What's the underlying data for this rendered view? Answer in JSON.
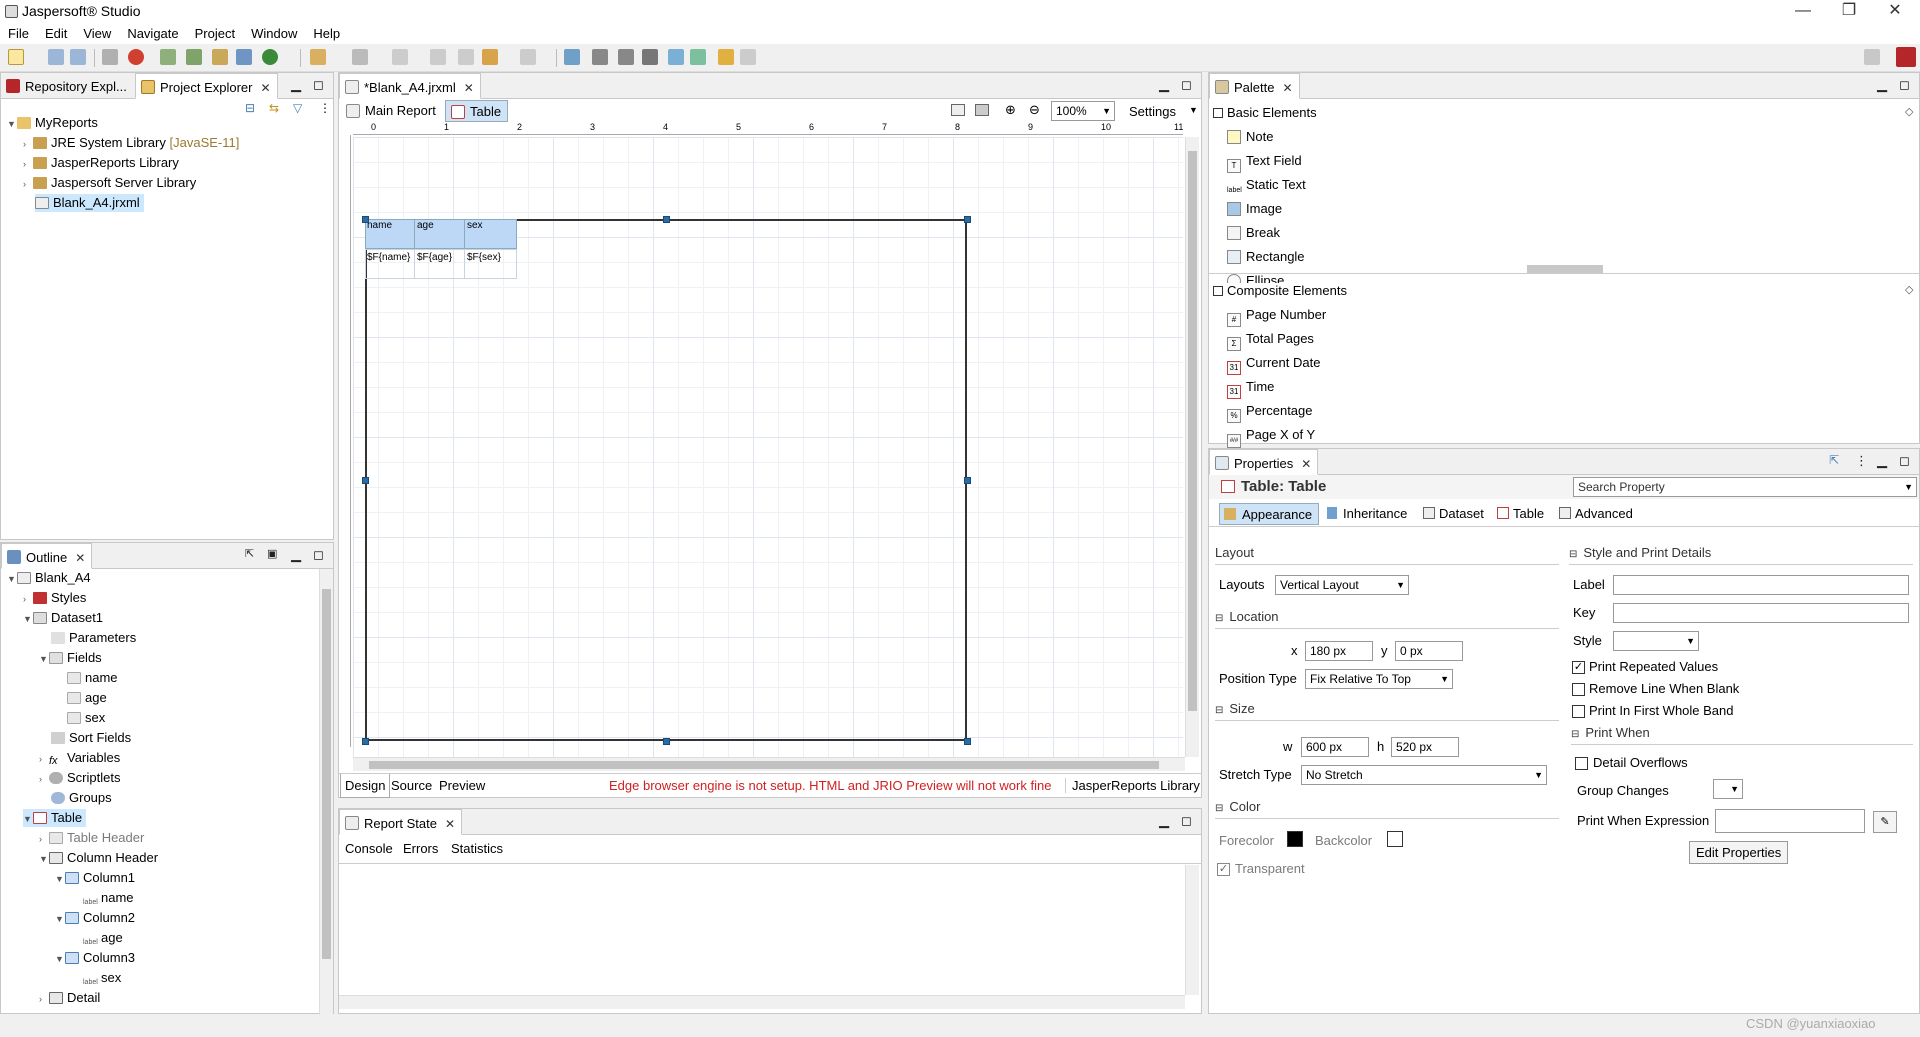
{
  "window": {
    "title": "Jaspersoft® Studio",
    "min": "—",
    "max": "❐",
    "close": "✕"
  },
  "menu": [
    "File",
    "Edit",
    "View",
    "Navigate",
    "Project",
    "Window",
    "Help"
  ],
  "left_top": {
    "tabs": [
      {
        "label": "Repository Expl..."
      },
      {
        "label": "Project Explorer"
      }
    ],
    "tree": [
      {
        "label": "MyReports",
        "suffix": ""
      },
      {
        "label": "JRE System Library",
        "suffix": "[JavaSE-11]"
      },
      {
        "label": "JasperReports Library",
        "suffix": ""
      },
      {
        "label": "Jaspersoft Server Library",
        "suffix": ""
      },
      {
        "label": "Blank_A4.jrxml",
        "suffix": ""
      }
    ]
  },
  "outline": {
    "tab": "Outline",
    "items": [
      {
        "label": "Blank_A4"
      },
      {
        "label": "Styles"
      },
      {
        "label": "Dataset1"
      },
      {
        "label": "Parameters"
      },
      {
        "label": "Fields"
      },
      {
        "label": "name"
      },
      {
        "label": "age"
      },
      {
        "label": "sex"
      },
      {
        "label": "Sort Fields"
      },
      {
        "label": "Variables"
      },
      {
        "label": "Scriptlets"
      },
      {
        "label": "Groups"
      },
      {
        "label": "Table"
      },
      {
        "label": "Table Header"
      },
      {
        "label": "Column Header"
      },
      {
        "label": "Column1"
      },
      {
        "label": "name"
      },
      {
        "label": "Column2"
      },
      {
        "label": "age"
      },
      {
        "label": "Column3"
      },
      {
        "label": "sex"
      },
      {
        "label": "Detail"
      }
    ]
  },
  "editor": {
    "file_tab": "*Blank_A4.jrxml",
    "sub_tabs": [
      "Main Report",
      "Table"
    ],
    "zoom": "100%",
    "settings": "Settings",
    "ruler": [
      "0",
      "1",
      "2",
      "3",
      "4",
      "5",
      "6",
      "7",
      "8",
      "9",
      "10",
      "11"
    ],
    "table_headers": [
      "name",
      "age",
      "sex"
    ],
    "table_fields": [
      "$F{name}",
      "$F{age}",
      "$F{sex}"
    ],
    "bottom_tabs": [
      "Design",
      "Source",
      "Preview"
    ],
    "warning": "Edge browser engine is not setup. HTML and JRIO Preview will not work fine",
    "library": "JasperReports Library"
  },
  "report_state": {
    "tab": "Report State",
    "sub_tabs": [
      "Console",
      "Errors",
      "Statistics"
    ]
  },
  "palette": {
    "tab": "Palette",
    "basic_title": "Basic Elements",
    "basic": [
      "Note",
      "Text Field",
      "Static Text",
      "Image",
      "Break",
      "Rectangle",
      "Ellipse"
    ],
    "composite_title": "Composite Elements",
    "composite": [
      "Page Number",
      "Total Pages",
      "Current Date",
      "Time",
      "Percentage",
      "Page X of Y"
    ]
  },
  "properties": {
    "tab": "Properties",
    "title": "Table: Table",
    "search_placeholder": "Search Property",
    "tabs": [
      "Appearance",
      "Inheritance",
      "Dataset",
      "Table",
      "Advanced"
    ],
    "layout_group": "Layout",
    "layouts_label": "Layouts",
    "layouts_value": "Vertical Layout",
    "location_group": "Location",
    "x_label": "x",
    "x_value": "180 px",
    "y_label": "y",
    "y_value": "0 px",
    "position_type_label": "Position Type",
    "position_type_value": "Fix Relative To Top",
    "size_group": "Size",
    "w_label": "w",
    "w_value": "600 px",
    "h_label": "h",
    "h_value": "520 px",
    "stretch_label": "Stretch Type",
    "stretch_value": "No Stretch",
    "color_group": "Color",
    "forecolor_label": "Forecolor",
    "forecolor": "#000000",
    "backcolor_label": "Backcolor",
    "backcolor": "#ffffff",
    "transparent_label": "Transparent",
    "style_group": "Style and Print Details",
    "label_label": "Label",
    "key_label": "Key",
    "style_label": "Style",
    "print_repeated": "Print Repeated Values",
    "remove_line": "Remove Line When Blank",
    "print_first": "Print In First Whole Band",
    "print_when_group": "Print When",
    "detail_overflows": "Detail Overflows",
    "group_changes": "Group Changes",
    "print_when_expr": "Print When Expression",
    "edit_properties": "Edit Properties"
  },
  "watermark": "CSDN @yuanxiaoxiao"
}
